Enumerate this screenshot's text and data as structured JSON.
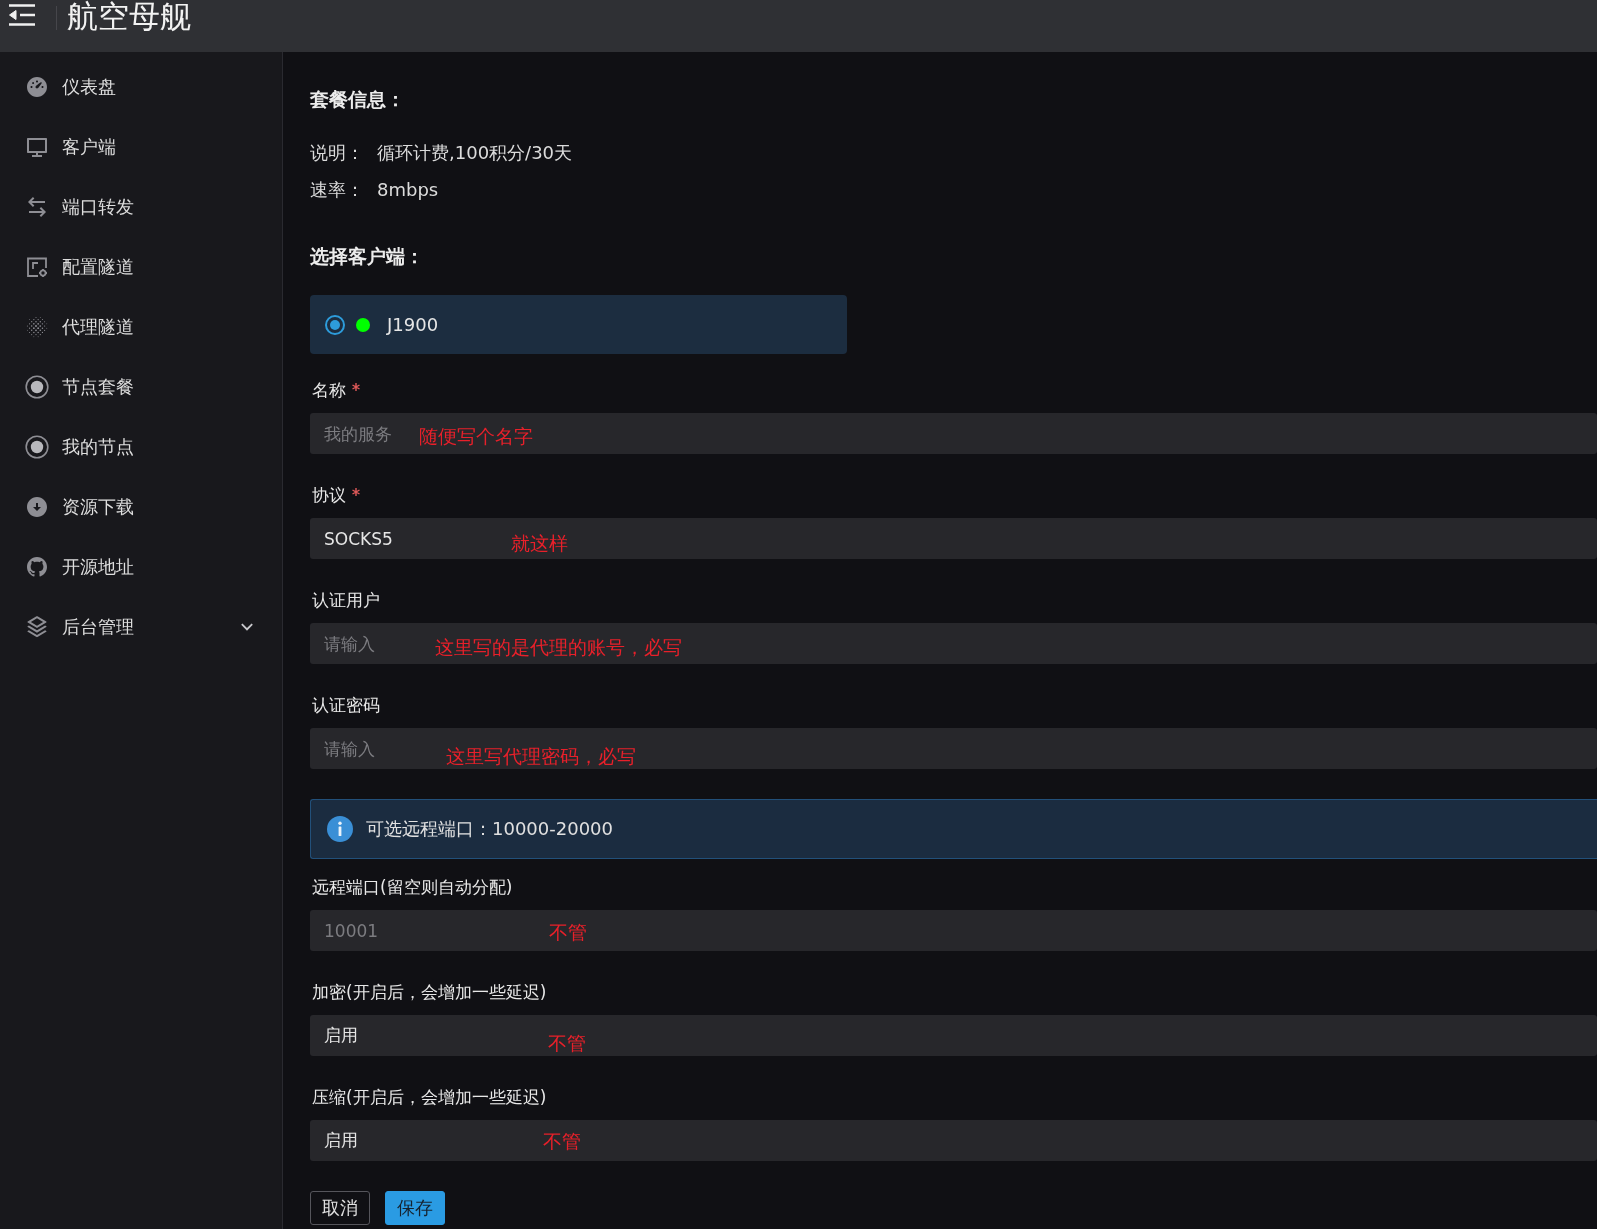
{
  "header": {
    "title": "航空母舰"
  },
  "sidebar": {
    "items": [
      {
        "label": "仪表盘",
        "kind": "link"
      },
      {
        "label": "客户端",
        "kind": "link"
      },
      {
        "label": "端口转发",
        "kind": "link"
      },
      {
        "label": "配置隧道",
        "kind": "link"
      },
      {
        "label": "代理隧道",
        "kind": "link"
      },
      {
        "label": "节点套餐",
        "kind": "link"
      },
      {
        "label": "我的节点",
        "kind": "link"
      },
      {
        "label": "资源下载",
        "kind": "link"
      },
      {
        "label": "开源地址",
        "kind": "link"
      },
      {
        "label": "后台管理",
        "kind": "group",
        "expanded": false
      }
    ]
  },
  "plan": {
    "title": "套餐信息：",
    "rows": [
      {
        "label": "说明：",
        "value": "循环计费,100积分/30天"
      },
      {
        "label": "速率：",
        "value": "8mbps"
      }
    ]
  },
  "clients": {
    "title": "选择客户端：",
    "items": [
      {
        "name": "J1900",
        "selected": true,
        "color": "#00ff00"
      }
    ]
  },
  "form": {
    "items": [
      {
        "kind": "input",
        "label": "名称",
        "required": true,
        "placeholder": "我的服务",
        "annotation": "随便写个名字"
      },
      {
        "kind": "select",
        "label": "协议",
        "required": true,
        "value": "SOCKS5",
        "annotation": "就这样"
      },
      {
        "kind": "input",
        "label": "认证用户",
        "required": false,
        "placeholder": "请输入",
        "annotation": "这里写的是代理的账号，必写"
      },
      {
        "kind": "input",
        "label": "认证密码",
        "required": false,
        "placeholder": "请输入",
        "annotation": "这里写代理密码，必写"
      },
      {
        "kind": "notice",
        "text": "可选远程端口：10000-20000"
      },
      {
        "kind": "input",
        "label": "远程端口(留空则自动分配)",
        "required": false,
        "placeholder": "10001",
        "annotation": "不管"
      },
      {
        "kind": "select",
        "label": "加密(开启后，会增加一些延迟)",
        "required": false,
        "value": "启用",
        "annotation": "不管"
      },
      {
        "kind": "select",
        "label": "压缩(开启后，会增加一些延迟)",
        "required": false,
        "value": "启用",
        "annotation": "不管"
      }
    ]
  },
  "buttons": [
    {
      "label": "取消",
      "kind": "secondary"
    },
    {
      "label": "保存",
      "kind": "primary"
    }
  ]
}
